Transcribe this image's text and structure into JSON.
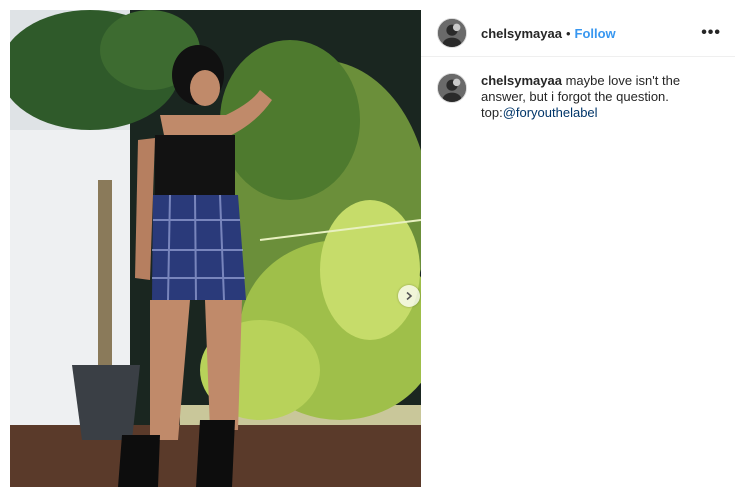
{
  "post": {
    "image_alt": "photo",
    "username": "chelsymayaa",
    "separator": "•",
    "follow_label": "Follow",
    "more_label": "•••",
    "caption": {
      "username": "chelsymayaa",
      "text": "maybe love isn't the answer, but i forgot the question.",
      "prefix": "top:",
      "mention": "@foryouthelabel"
    }
  },
  "icons": {
    "next": "chevron-right-icon",
    "more": "more-options-icon"
  }
}
